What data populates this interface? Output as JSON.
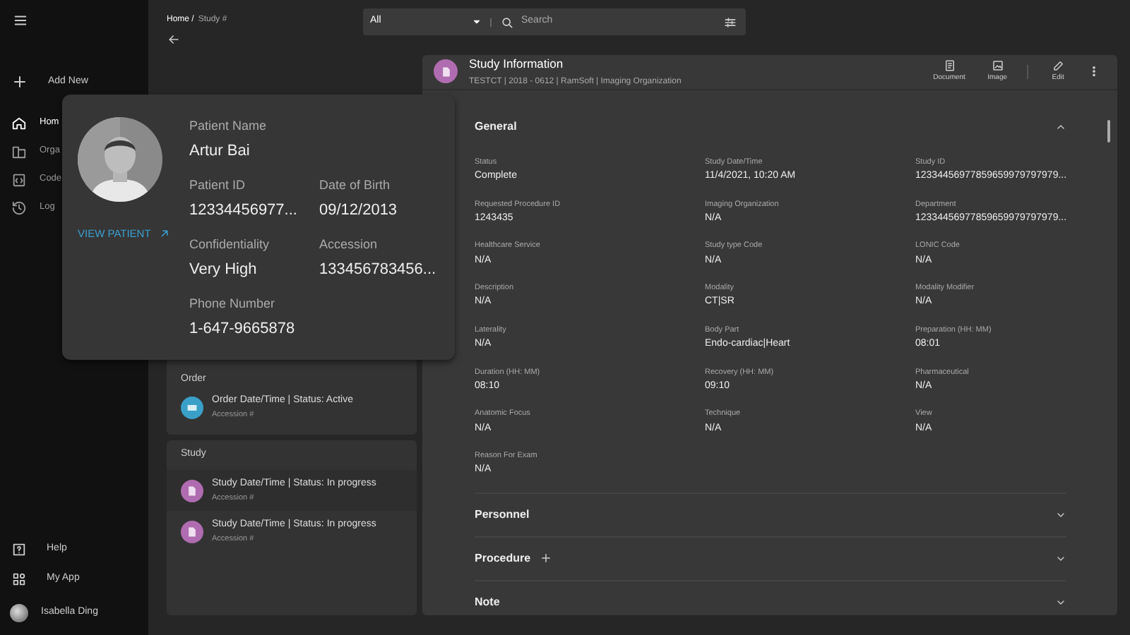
{
  "sidebar": {
    "add_new": "Add New",
    "items": [
      {
        "label": "Hom",
        "selected": true
      },
      {
        "label": "Orga",
        "selected": false
      },
      {
        "label": "Code",
        "selected": false
      },
      {
        "label": "Log",
        "selected": false
      }
    ],
    "bottom_items": [
      {
        "label": "Help"
      },
      {
        "label": "My App"
      }
    ],
    "user": {
      "name": "Isabella Ding"
    }
  },
  "breadcrumb": {
    "home": "Home /",
    "current": "Study #"
  },
  "search": {
    "scope": "All",
    "placeholder": "Search"
  },
  "order_card": {
    "title": "Order",
    "items": [
      {
        "title": "Order Date/Time | Status: Active",
        "subtitle": "Accession #",
        "kind": "order"
      }
    ]
  },
  "study_card": {
    "title": "Study",
    "items": [
      {
        "title": "Study Date/Time | Status: In progress",
        "subtitle": "Accession #",
        "kind": "study"
      },
      {
        "title": "Study Date/Time | Status: In progress",
        "subtitle": "Accession #",
        "kind": "study"
      }
    ]
  },
  "study_panel": {
    "title": "Study Information",
    "subtitle": "TESTCT | 2018 - 0612 | RamSoft | Imaging Organization",
    "actions": [
      {
        "label": "Document"
      },
      {
        "label": "Image"
      },
      {
        "label": "Edit"
      }
    ],
    "sections": [
      {
        "title": "General",
        "expanded": true,
        "addable": false,
        "fields": [
          {
            "label": "Status",
            "value": "Complete"
          },
          {
            "label": "Study Date/Time",
            "value": "11/4/2021, 10:20 AM"
          },
          {
            "label": "Study ID",
            "value": "12334456977859659979797979..."
          },
          {
            "label": "Requested Procedure ID",
            "value": "1243435"
          },
          {
            "label": "Imaging Organization",
            "value": "N/A"
          },
          {
            "label": "Department",
            "value": "12334456977859659979797979..."
          },
          {
            "label": "Healthcare Service",
            "value": "N/A"
          },
          {
            "label": "Study type Code",
            "value": "N/A"
          },
          {
            "label": "LONIC Code",
            "value": "N/A"
          },
          {
            "label": "Description",
            "value": "N/A"
          },
          {
            "label": "Modality",
            "value": "CT|SR"
          },
          {
            "label": "Modality Modifier",
            "value": "N/A"
          },
          {
            "label": "Laterality",
            "value": "N/A"
          },
          {
            "label": "Body Part",
            "value": "Endo-cardiac|Heart"
          },
          {
            "label": "Preparation (HH: MM)",
            "value": "08:01"
          },
          {
            "label": "Duration (HH: MM)",
            "value": "08:10"
          },
          {
            "label": "Recovery (HH: MM)",
            "value": "09:10"
          },
          {
            "label": "Pharmaceutical",
            "value": "N/A"
          },
          {
            "label": "Anatomic Focus",
            "value": "N/A"
          },
          {
            "label": "Technique",
            "value": "N/A"
          },
          {
            "label": "View",
            "value": "N/A"
          },
          {
            "label": "Reason For Exam",
            "value": "N/A"
          }
        ]
      },
      {
        "title": "Personnel",
        "expanded": false,
        "addable": false
      },
      {
        "title": "Procedure",
        "expanded": false,
        "addable": true
      },
      {
        "title": "Note",
        "expanded": false,
        "addable": false
      }
    ]
  },
  "patient_popup": {
    "link": "VIEW PATIENT",
    "fields": [
      {
        "label": "Patient Name",
        "value": "Artur Bai",
        "wide": true
      },
      {
        "label": "Patient ID",
        "value": "12334456977...",
        "wide": false
      },
      {
        "label": "Date of Birth",
        "value": "09/12/2013",
        "wide": false
      },
      {
        "label": "Confidentiality",
        "value": "Very High",
        "wide": false
      },
      {
        "label": "Accession",
        "value": "133456783456...",
        "wide": false
      },
      {
        "label": "Phone Number",
        "value": "1-647-9665878",
        "wide": true
      }
    ]
  }
}
